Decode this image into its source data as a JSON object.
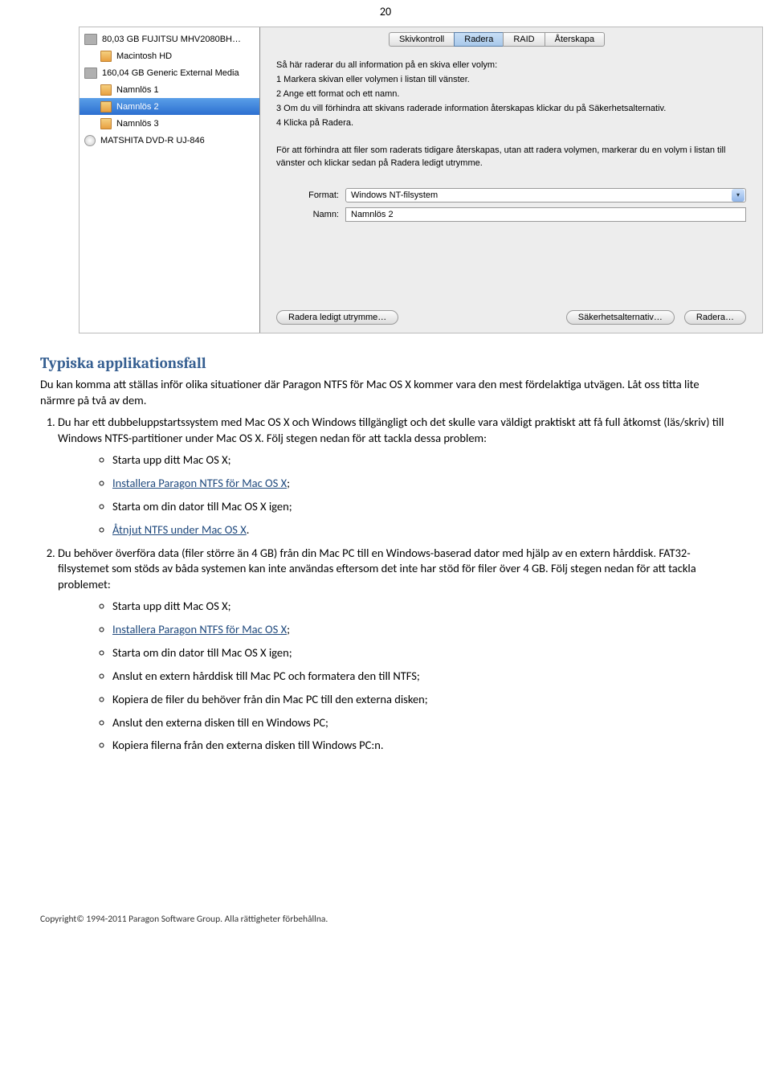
{
  "page_number": "20",
  "screenshot": {
    "sidebar": {
      "items": [
        {
          "label": "80,03 GB FUJITSU MHV2080BH…",
          "type": "drive",
          "indent": 0
        },
        {
          "label": "Macintosh HD",
          "type": "vol",
          "indent": 1
        },
        {
          "label": "160,04 GB Generic External Media",
          "type": "drive",
          "indent": 0
        },
        {
          "label": "Namnlös 1",
          "type": "vol",
          "indent": 1
        },
        {
          "label": "Namnlös 2",
          "type": "vol",
          "indent": 1,
          "selected": true
        },
        {
          "label": "Namnlös 3",
          "type": "vol",
          "indent": 1
        },
        {
          "label": "MATSHITA DVD-R UJ-846",
          "type": "dvd",
          "indent": 0
        }
      ]
    },
    "tabs": [
      "Skivkontroll",
      "Radera",
      "RAID",
      "Återskapa"
    ],
    "active_tab_index": 1,
    "instructions": {
      "intro": "Så här raderar du all information på en skiva eller volym:",
      "steps": [
        "1  Markera skivan eller volymen i listan till vänster.",
        "2  Ange ett format och ett namn.",
        "3  Om du vill förhindra att skivans raderade information återskapas klickar du på Säkerhetsalternativ.",
        "4  Klicka på Radera."
      ],
      "note": "För att förhindra att filer som raderats tidigare återskapas, utan att radera volymen, markerar du en volym i listan till vänster och klickar sedan på Radera ledigt utrymme."
    },
    "form": {
      "format_label": "Format:",
      "format_value": "Windows NT-filsystem",
      "name_label": "Namn:",
      "name_value": "Namnlös 2"
    },
    "buttons": {
      "erase_free": "Radera ledigt utrymme…",
      "security": "Säkerhetsalternativ…",
      "erase": "Radera…"
    }
  },
  "section_title": "Typiska applikationsfall",
  "intro_paragraph": "Du kan komma att ställas inför olika situationer där Paragon NTFS för Mac OS X kommer vara den mest fördelaktiga utvägen. Låt oss titta lite närmre på två av dem.",
  "item1_text": "Du har ett dubbeluppstartssystem med Mac OS X och Windows tillgängligt och det skulle vara väldigt praktiskt att få full åtkomst (läs/skriv) till Windows NTFS-partitioner under Mac OS X. Följ stegen nedan för att tackla dessa problem:",
  "item1_bullets": [
    {
      "text": "Starta upp ditt Mac OS X;"
    },
    {
      "text": "Installera Paragon NTFS för Mac OS X",
      "link": true,
      "suffix": ";"
    },
    {
      "text": "Starta om din dator till Mac OS X igen;"
    },
    {
      "text": "Åtnjut NTFS under Mac OS X",
      "link": true,
      "suffix": "."
    }
  ],
  "item2_text": "Du behöver överföra data (filer större än 4 GB) från din Mac PC till en Windows-baserad dator med hjälp av en extern hårddisk. FAT32-filsystemet som stöds av båda systemen kan inte användas eftersom det inte har stöd för filer över 4 GB. Följ stegen nedan för att tackla problemet:",
  "item2_bullets": [
    {
      "text": "Starta upp ditt Mac OS X;"
    },
    {
      "text": "Installera Paragon NTFS för Mac OS X",
      "link": true,
      "suffix": ";"
    },
    {
      "text": "Starta om din dator till Mac OS X igen;"
    },
    {
      "text": "Anslut en extern hårddisk till Mac PC och formatera den till NTFS;"
    },
    {
      "text": "Kopiera de filer du behöver från din Mac PC till den externa disken;"
    },
    {
      "text": "Anslut den externa disken till en Windows PC;"
    },
    {
      "text": "Kopiera filerna från den externa disken till Windows PC:n."
    }
  ],
  "copyright": "Copyright© 1994-2011 Paragon Software Group. Alla rättigheter förbehållna."
}
